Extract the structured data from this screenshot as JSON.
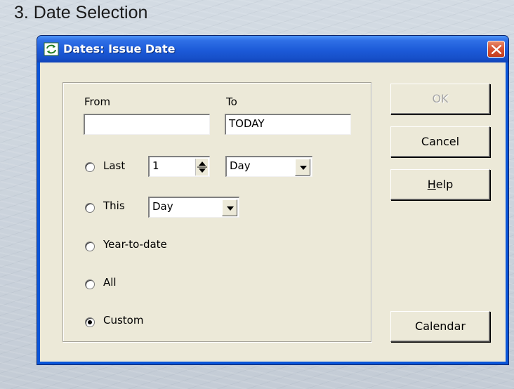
{
  "slide": {
    "title": "3. Date Selection"
  },
  "dialog": {
    "title": "Dates: Issue Date",
    "from_label": "From",
    "to_label": "To",
    "from_value": "",
    "to_value": "TODAY",
    "last_label": "Last",
    "last_count": "1",
    "last_unit": "Day",
    "this_label": "This",
    "this_unit": "Day",
    "ytd_label": "Year-to-date",
    "all_label": "All",
    "custom_label": "Custom",
    "selected_option": "Custom",
    "buttons": {
      "ok": "OK",
      "cancel": "Cancel",
      "help_accel": "H",
      "help_rest": "elp",
      "calendar": "Calendar"
    }
  },
  "colors": {
    "titlebar": "#1c5ad8",
    "client": "#ece9d8",
    "close": "#d85636"
  }
}
